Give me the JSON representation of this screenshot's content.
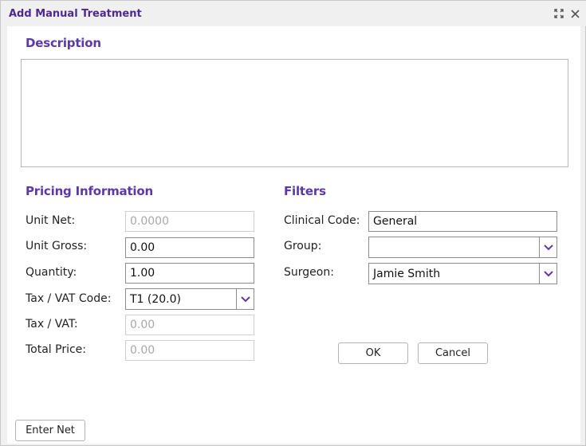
{
  "window": {
    "title": "Add Manual Treatment",
    "maximize_icon": "maximize-icon",
    "close_icon": "close-icon"
  },
  "description": {
    "heading": "Description",
    "value": ""
  },
  "pricing": {
    "heading": "Pricing Information",
    "unit_net": {
      "label": "Unit Net:",
      "value": "0.0000"
    },
    "unit_gross": {
      "label": "Unit Gross:",
      "value": "0.00"
    },
    "quantity": {
      "label": "Quantity:",
      "value": "1.00"
    },
    "tax_code": {
      "label": "Tax / VAT Code:",
      "value": "T1 (20.0)"
    },
    "tax_vat": {
      "label": "Tax / VAT:",
      "value": "0.00"
    },
    "total_price": {
      "label": "Total Price:",
      "value": "0.00"
    }
  },
  "filters": {
    "heading": "Filters",
    "clinical_code": {
      "label": "Clinical Code:",
      "value": "General"
    },
    "group": {
      "label": "Group:",
      "value": ""
    },
    "surgeon": {
      "label": "Surgeon:",
      "value": "Jamie Smith"
    }
  },
  "buttons": {
    "ok": "OK",
    "cancel": "Cancel",
    "enter_net": "Enter Net"
  },
  "colors": {
    "title": "#4b2b8f",
    "accent": "#5b3aa8",
    "dropdown_chevron": "#5b3aa8"
  }
}
